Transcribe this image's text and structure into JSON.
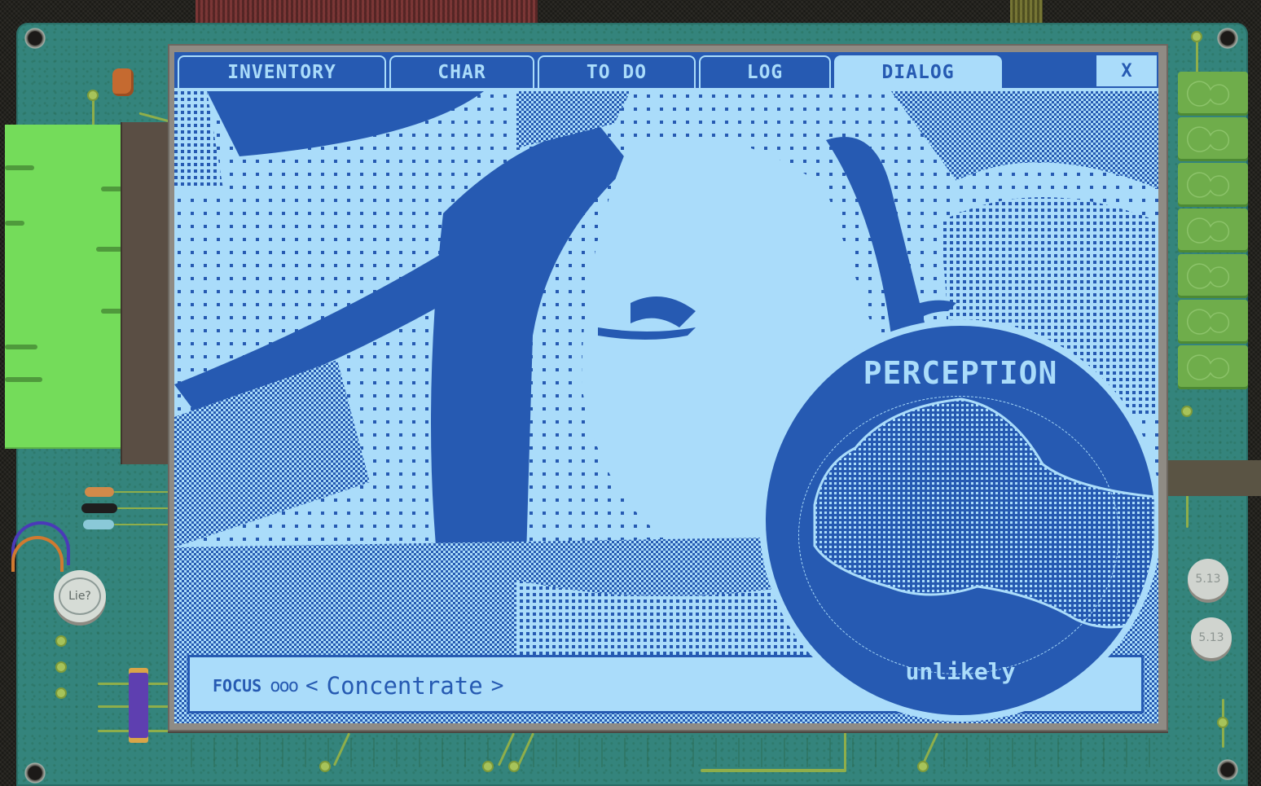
{
  "tabs": [
    {
      "label": "INVENTORY",
      "active": false
    },
    {
      "label": "CHAR",
      "active": false
    },
    {
      "label": "TO DO",
      "active": false
    },
    {
      "label": "LOG",
      "active": false
    },
    {
      "label": "DIALOG",
      "active": true
    }
  ],
  "close_label": "X",
  "dialog": {
    "focus_label": "FOCUS",
    "focus_dots": "ooo",
    "prev_arrow": "<",
    "option": "Concentrate",
    "next_arrow": ">"
  },
  "skill_check": {
    "skill": "PERCEPTION",
    "result": "unlikely"
  },
  "board_labels": {
    "lie_component": "Lie?",
    "coin_1": "5.13",
    "coin_2": "5.13"
  },
  "colors": {
    "screen_dark": "#265ab2",
    "screen_light": "#aadcfa",
    "board": "#34847c",
    "green_block": "#74dc5a"
  }
}
